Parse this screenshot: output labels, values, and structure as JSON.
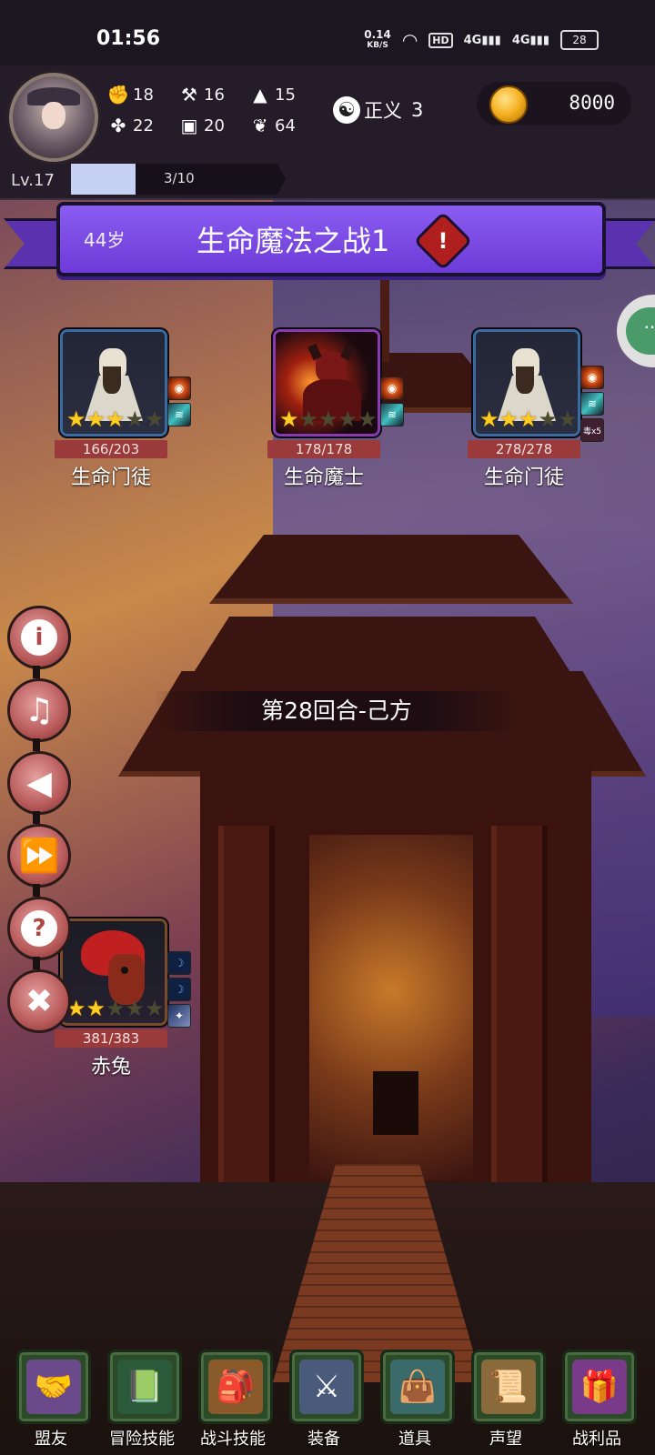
{
  "status_bar": {
    "time": "01:56",
    "net_speed_value": "0.14",
    "net_speed_unit": "KB/S",
    "hd_label": "HD",
    "signal1": "4G",
    "signal2": "4G",
    "battery": "28"
  },
  "player": {
    "stats": [
      {
        "icon": "fist-icon",
        "value": "18"
      },
      {
        "icon": "hammer-icon",
        "value": "16"
      },
      {
        "icon": "wizard-hat-icon",
        "value": "15"
      },
      {
        "icon": "clover-icon",
        "value": "22"
      },
      {
        "icon": "chest-armor-icon",
        "value": "20"
      },
      {
        "icon": "wings-icon",
        "value": "64"
      }
    ],
    "alignment_label": "正义",
    "alignment_value": "3",
    "gold": "8000",
    "level": "Lv.17",
    "xp_text": "3/10",
    "xp_progress": 0.3
  },
  "battle": {
    "age": "44岁",
    "title": "生命魔法之战1",
    "alert_symbol": "!",
    "round_text": "第28回合-己方"
  },
  "enemies": [
    {
      "name": "生命门徒",
      "hp": "166/203",
      "stars": 3,
      "max_stars": 5,
      "skills": [
        "fire",
        "wind"
      ]
    },
    {
      "name": "生命魔士",
      "hp": "178/178",
      "stars": 1,
      "max_stars": 5,
      "skills": [
        "fire",
        "wind"
      ]
    },
    {
      "name": "生命门徒",
      "hp": "278/278",
      "stars": 3,
      "max_stars": 5,
      "skills": [
        "fire",
        "wind",
        "poison"
      ],
      "skill_badge": "毒x5"
    }
  ],
  "allies": [
    {
      "name": "赤兔",
      "hp": "381/383",
      "stars": 2,
      "max_stars": 5,
      "skills": [
        "moon",
        "moon",
        "star"
      ]
    }
  ],
  "side_buttons": [
    {
      "name": "info-button",
      "icon": "info-icon",
      "glyph": "i"
    },
    {
      "name": "music-button",
      "icon": "music-note-icon",
      "glyph": "♫"
    },
    {
      "name": "sound-button",
      "icon": "speaker-icon",
      "glyph": "◀"
    },
    {
      "name": "fast-forward-button",
      "icon": "fast-forward-icon",
      "glyph": "⏩"
    },
    {
      "name": "help-button",
      "icon": "question-icon",
      "glyph": "?"
    },
    {
      "name": "close-button",
      "icon": "close-icon",
      "glyph": "✖"
    }
  ],
  "nav": [
    {
      "label": "盟友",
      "icon": "handshake-icon",
      "glyph": "🤝",
      "color": "#6a4a8a"
    },
    {
      "label": "冒险技能",
      "icon": "spellbook-icon",
      "glyph": "📗",
      "color": "#2a5a3a"
    },
    {
      "label": "战斗技能",
      "icon": "backpack-icon",
      "glyph": "🎒",
      "color": "#8a5a2a"
    },
    {
      "label": "装备",
      "icon": "crossed-swords-icon",
      "glyph": "⚔",
      "color": "#4a5a7a"
    },
    {
      "label": "道具",
      "icon": "satchel-icon",
      "glyph": "👜",
      "color": "#3a6a6a"
    },
    {
      "label": "声望",
      "icon": "scroll-icon",
      "glyph": "📜",
      "color": "#8a6a3a"
    },
    {
      "label": "战利品",
      "icon": "treasure-chest-icon",
      "glyph": "🎁",
      "color": "#7a3a8a"
    }
  ]
}
